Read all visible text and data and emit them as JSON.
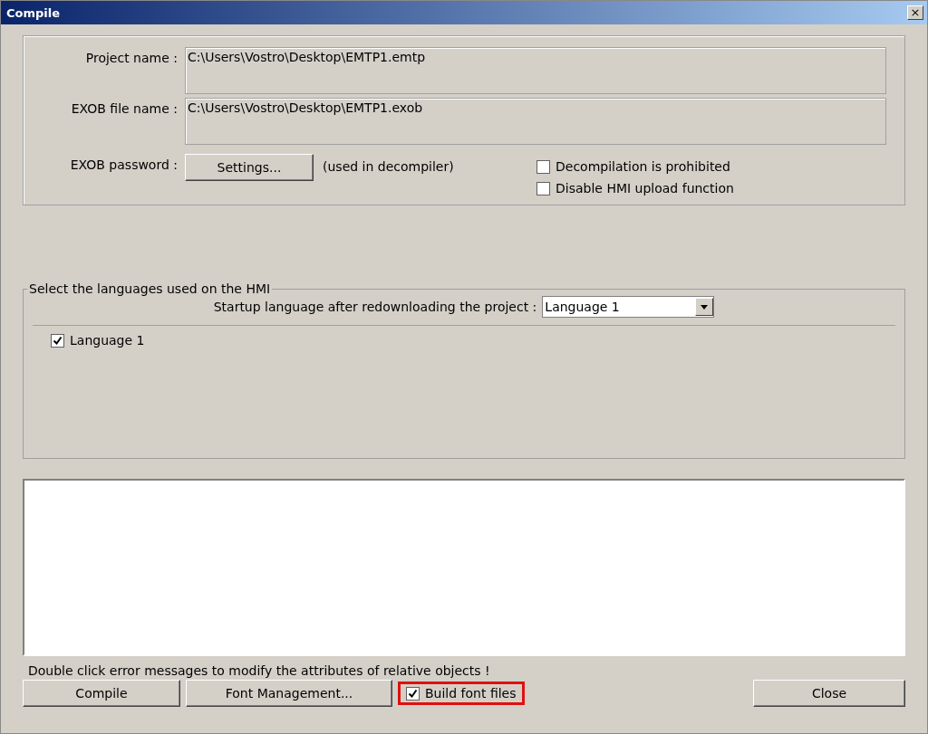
{
  "window": {
    "title": "Compile",
    "close_glyph": "×"
  },
  "project": {
    "fields": [
      {
        "label": "Project name :",
        "value": "C:\\Users\\Vostro\\Desktop\\EMTP1.emtp"
      },
      {
        "label": "EXOB file name :",
        "value": "C:\\Users\\Vostro\\Desktop\\EMTP1.exob"
      }
    ],
    "password_label": "EXOB password :",
    "settings_button": "Settings...",
    "password_note": "(used in decompiler)",
    "options": [
      {
        "label": "Decompilation is prohibited",
        "checked": false
      },
      {
        "label": "Disable HMI upload function",
        "checked": false
      }
    ]
  },
  "languages": {
    "legend": "Select the languages used on the HMI",
    "startup_label": "Startup language after redownloading the project :",
    "startup_value": "Language 1",
    "items": [
      {
        "label": "Language 1",
        "checked": true
      }
    ]
  },
  "message": "Double click error messages to modify the attributes of relative objects !",
  "buttons": {
    "compile": "Compile",
    "font_management": "Font Management...",
    "close": "Close"
  },
  "build_fonts": {
    "label": "Build font files",
    "checked": true,
    "highlighted": true
  }
}
